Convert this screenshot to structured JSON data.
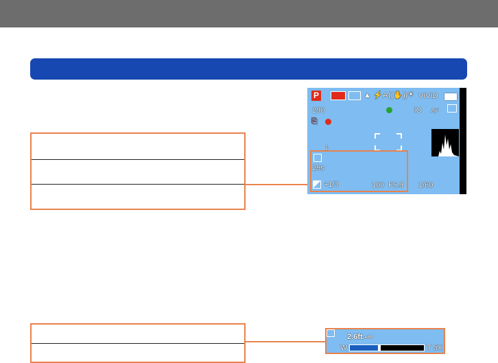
{
  "lcd": {
    "mode": "P",
    "quality_icons": [
      "AVCHD FHD",
      "12M",
      "quality",
      "flash-auto",
      "stabilizer",
      "white-balance"
    ],
    "photo_style": "VIVID",
    "shots_remaining": "290",
    "self_timer_value": "29s",
    "exposure_comp": "+1/3",
    "iso": "100",
    "aperture": "F5.9",
    "shutter": "1/60",
    "af_label": "AF",
    "intelligent_label": "iO",
    "timer_label": "1"
  },
  "zoom_panel": {
    "focus_range": "2.6ft.-∞",
    "wide_label": "W",
    "tele_label": "T 5X",
    "zoom_fraction": 0.38
  },
  "colors": {
    "accent": "#e9824c",
    "section_bar": "#1747b0",
    "lcd_bg": "#7ebcf1",
    "top_bar": "#6d6d6d"
  }
}
